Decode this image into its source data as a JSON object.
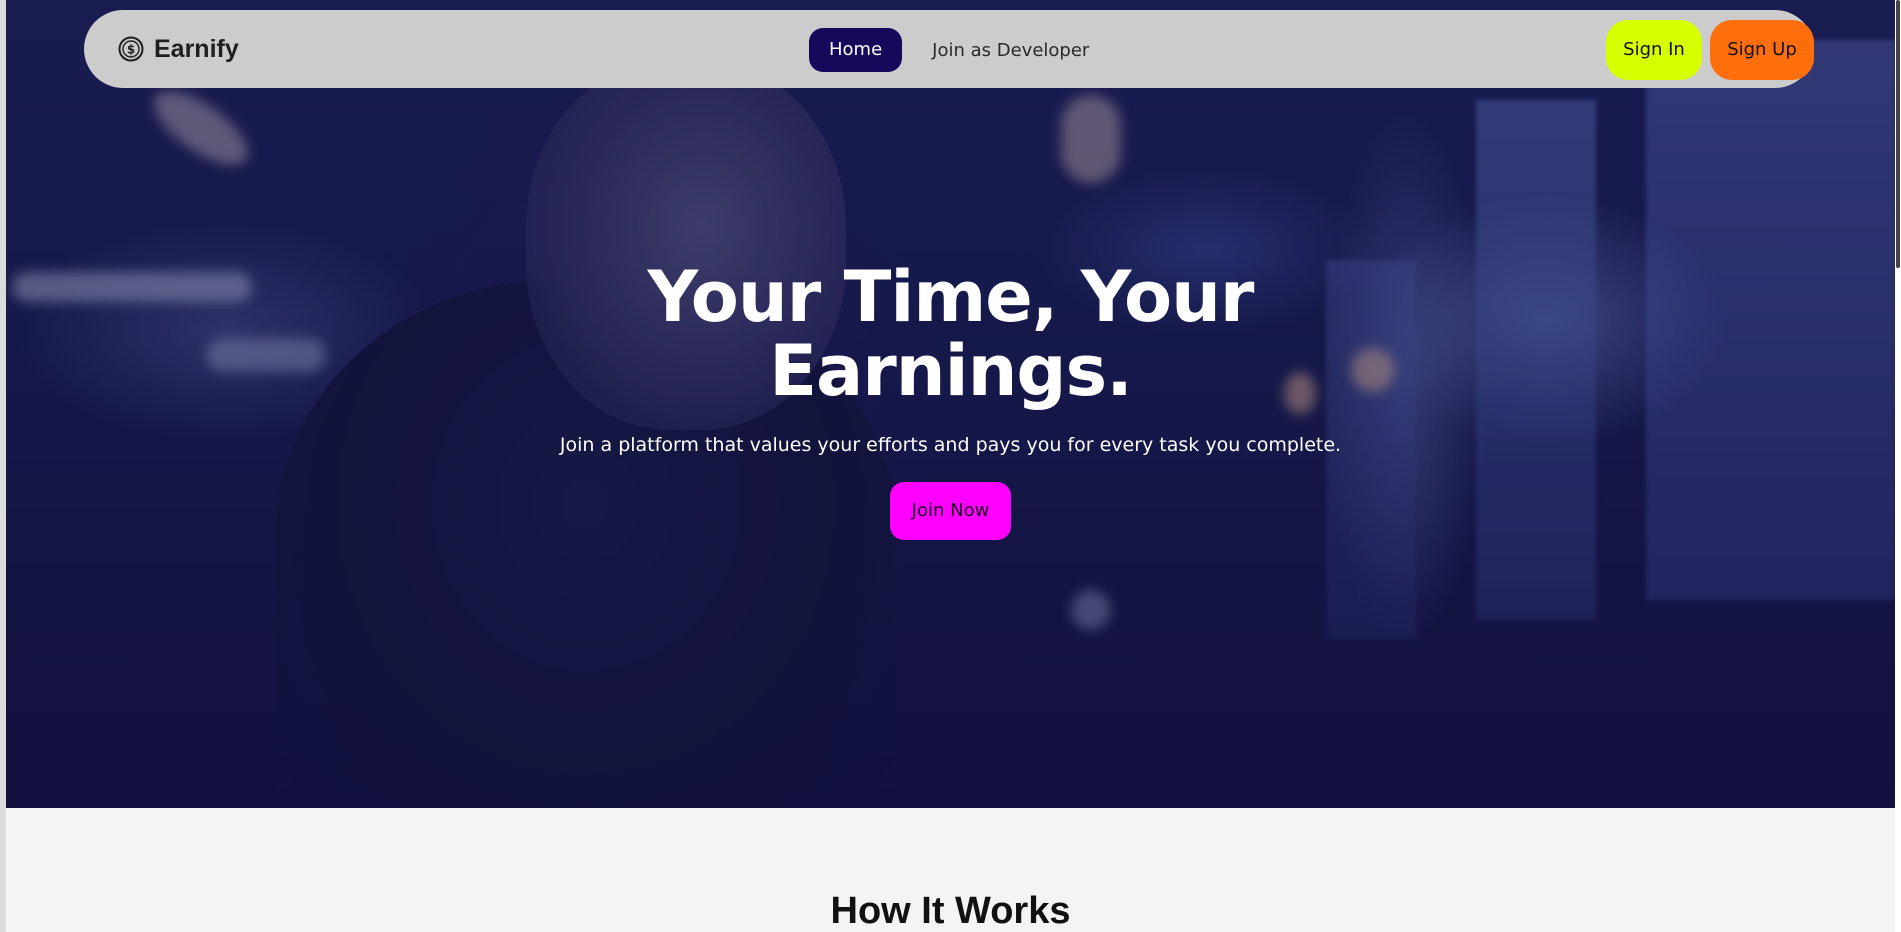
{
  "navbar": {
    "brand_name": "Earnify",
    "brand_icon": "dollar-coin-icon",
    "links": [
      {
        "label": "Home",
        "active": true
      },
      {
        "label": "Join as Developer",
        "active": false
      }
    ],
    "sign_in_label": "Sign In",
    "sign_up_label": "Sign Up"
  },
  "hero": {
    "title_line1": "Your Time, Your",
    "title_line2": "Earnings.",
    "subtitle": "Join a platform that values your efforts and pays you for every task you complete.",
    "cta_label": "Join Now",
    "background_image": "developer-at-computer-night-photo"
  },
  "section": {
    "how_it_works_title": "How It Works"
  },
  "colors": {
    "home_active": "#15095c",
    "sign_in": "#d7ff00",
    "sign_up": "#ff6e0c",
    "cta": "#ff00ff",
    "navbar_bg": "#cccccc"
  }
}
